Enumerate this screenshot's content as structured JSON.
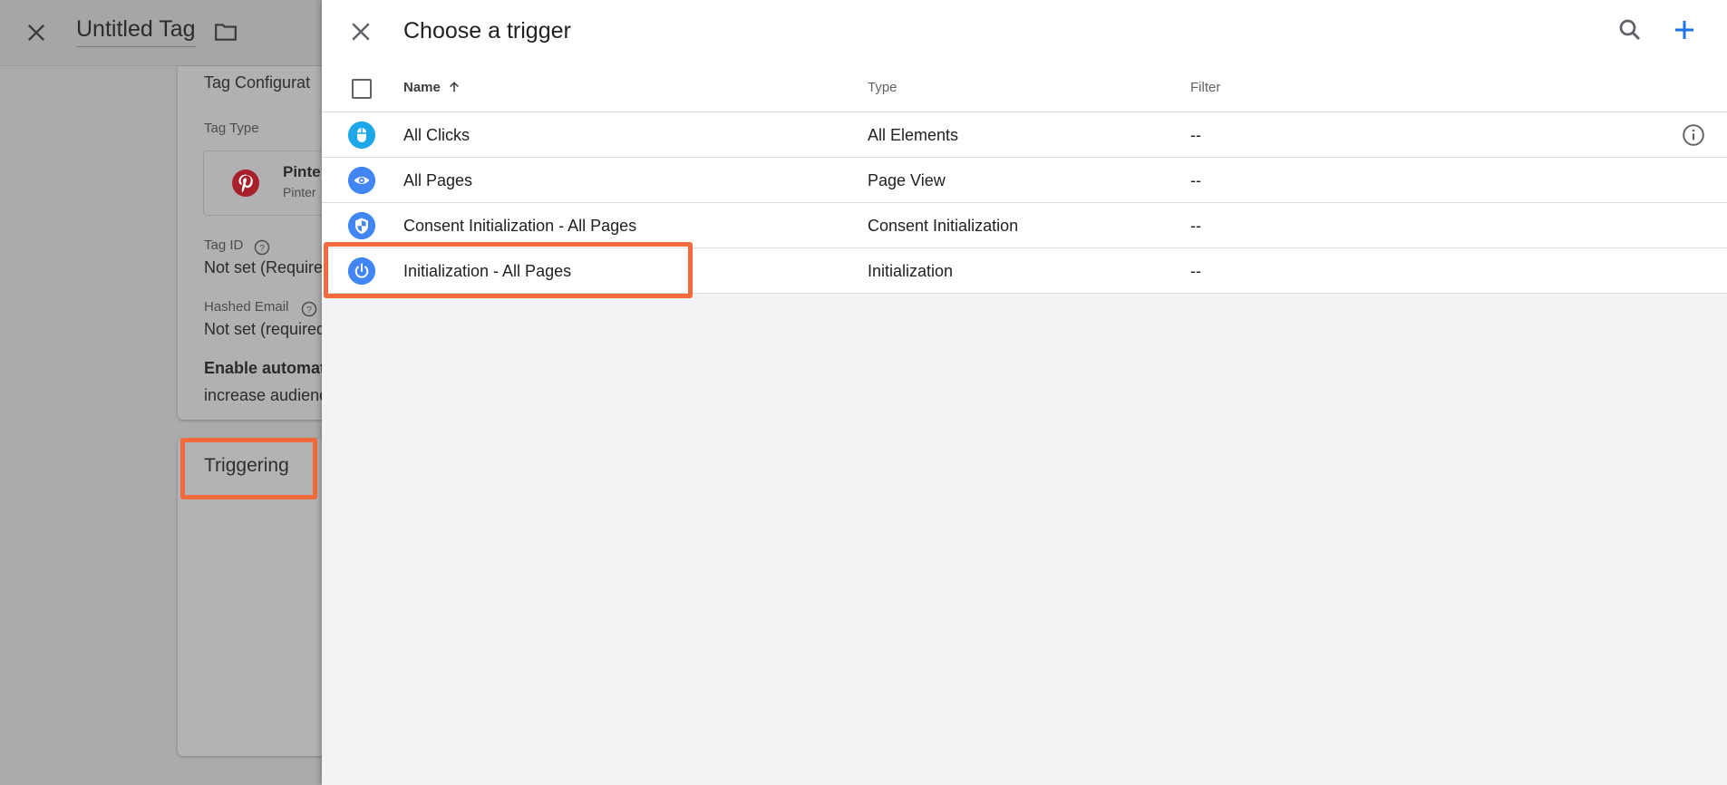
{
  "background": {
    "tag_title": "Untitled Tag",
    "config_title": "Tag Configurat",
    "tag_type_label": "Tag Type",
    "tag_type_name": "Pinte",
    "tag_type_sub": "Pinter",
    "tag_id_label": "Tag ID",
    "tag_id_value": "Not set (Require",
    "hashed_email_label": "Hashed Email",
    "hashed_email_value": "Not set (required",
    "enable_auto_text": "Enable automati",
    "increase_text": "increase audienc",
    "triggering_title": "Triggering"
  },
  "panel": {
    "title": "Choose a trigger",
    "columns": {
      "name": "Name",
      "type": "Type",
      "filter": "Filter"
    },
    "rows": [
      {
        "name": "All Clicks",
        "type": "All Elements",
        "filter": "--",
        "icon": "mouse-icon"
      },
      {
        "name": "All Pages",
        "type": "Page View",
        "filter": "--",
        "icon": "eye-icon"
      },
      {
        "name": "Consent Initialization - All Pages",
        "type": "Consent Initialization",
        "filter": "--",
        "icon": "shield-icon"
      },
      {
        "name": "Initialization - All Pages",
        "type": "Initialization",
        "filter": "--",
        "icon": "power-icon"
      }
    ]
  },
  "colors": {
    "accent": "#1a73e8",
    "highlight": "#f26b3a",
    "pinterest": "#bd081c"
  }
}
